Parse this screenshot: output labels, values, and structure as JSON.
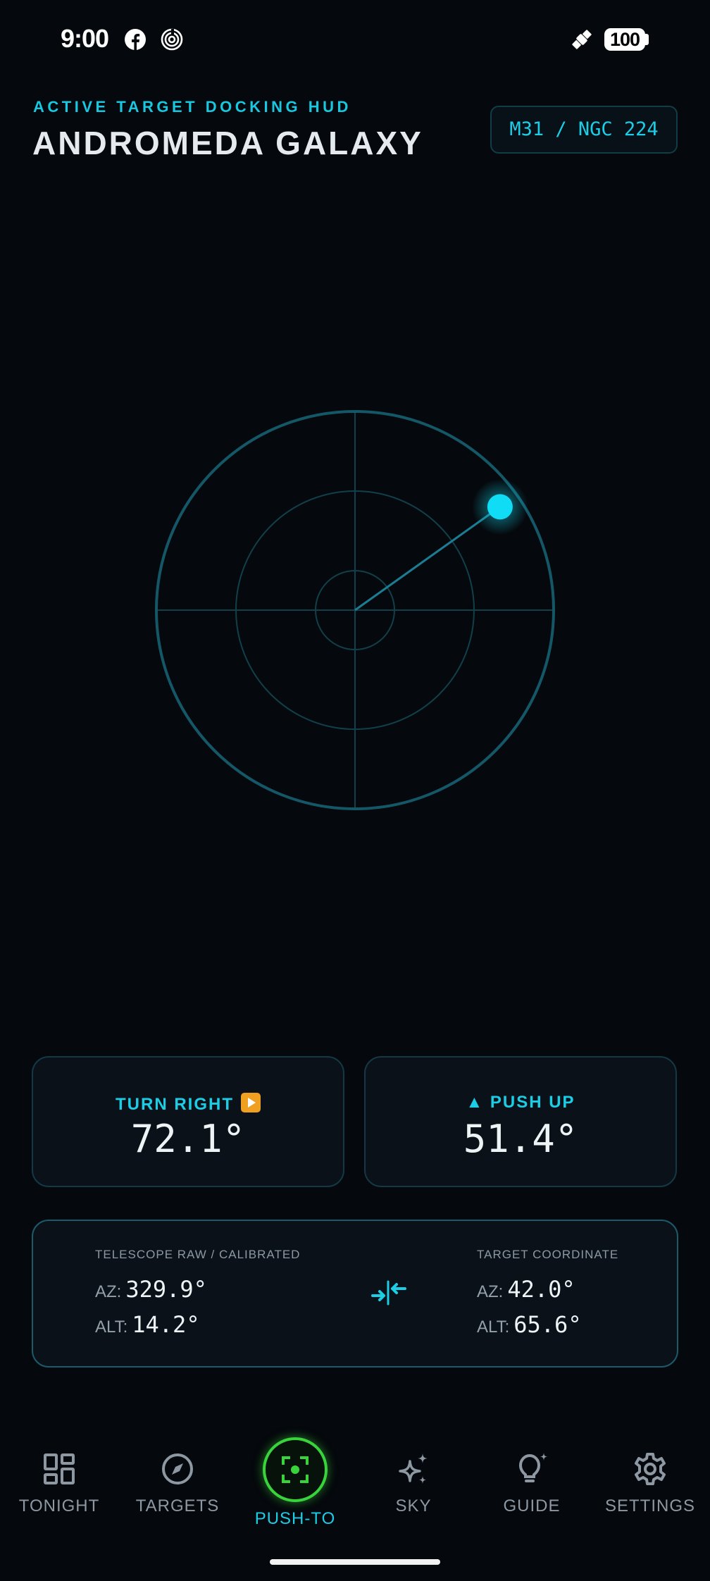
{
  "status_bar": {
    "time": "9:00",
    "battery": "100"
  },
  "header": {
    "subtitle": "ACTIVE TARGET DOCKING HUD",
    "title": "ANDROMEDA GALAXY",
    "catalog": "M31 / NGC 224"
  },
  "radar": {
    "target_offset_x": 0.73,
    "target_offset_y": 0.52
  },
  "directions": {
    "horizontal": {
      "label": "TURN RIGHT",
      "value": "72.1°"
    },
    "vertical": {
      "arrow": "▲",
      "label": "PUSH UP",
      "value": "51.4°"
    }
  },
  "coordinates": {
    "telescope": {
      "heading": "TELESCOPE RAW / CALIBRATED",
      "az_label": "AZ:",
      "az": "329.9°",
      "alt_label": "ALT:",
      "alt": "14.2°"
    },
    "target": {
      "heading": "TARGET COORDINATE",
      "az_label": "AZ:",
      "az": "42.0°",
      "alt_label": "ALT:",
      "alt": "65.6°"
    }
  },
  "nav": {
    "tonight": "TONIGHT",
    "targets": "TARGETS",
    "push_to": "PUSH-TO",
    "sky": "SKY",
    "guide": "GUIDE",
    "settings": "SETTINGS"
  },
  "colors": {
    "accent": "#1ccde6",
    "active_ring": "#39d43c",
    "background": "#05080c"
  }
}
